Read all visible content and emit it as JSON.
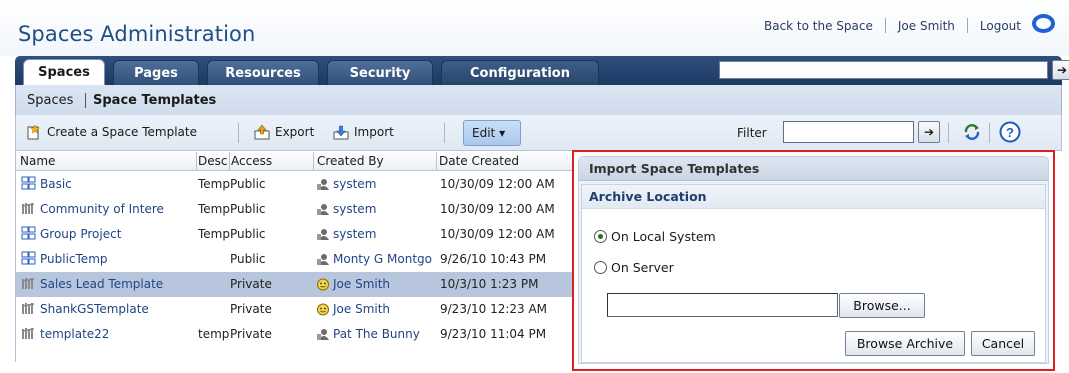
{
  "header": {
    "title": "Spaces Administration",
    "back_link": "Back to the Space",
    "user": "Joe Smith",
    "logout": "Logout"
  },
  "tabs": [
    {
      "label": "Spaces",
      "active": true
    },
    {
      "label": "Pages",
      "active": false
    },
    {
      "label": "Resources",
      "active": false
    },
    {
      "label": "Security",
      "active": false
    },
    {
      "label": "Configuration",
      "active": false
    }
  ],
  "tabs_search": {
    "placeholder": "",
    "go_glyph": "➔"
  },
  "breadcrumb": {
    "root": "Spaces",
    "current": "Space Templates"
  },
  "toolbar": {
    "create": "Create a Space Template",
    "export": "Export",
    "import": "Import",
    "edit": "Edit",
    "edit_caret": "▾",
    "filter_label": "Filter",
    "filter_value": "",
    "go_glyph": "➔",
    "help_glyph": "?"
  },
  "table": {
    "headers": {
      "name": "Name",
      "desc": "Desc",
      "access": "Access",
      "created_by": "Created By",
      "date": "Date Created"
    },
    "rows": [
      {
        "name": "Basic",
        "desc": "Temp",
        "access": "Public",
        "created_by": "system",
        "date": "10/30/09 12:00 AM",
        "icon": "template-icon",
        "user_icon": "system-user-icon",
        "selected": false
      },
      {
        "name": "Community of Intere",
        "desc": "Temp",
        "access": "Public",
        "created_by": "system",
        "date": "10/30/09 12:00 AM",
        "icon": "community-template-icon",
        "user_icon": "system-user-icon",
        "selected": false
      },
      {
        "name": "Group Project",
        "desc": "Temp",
        "access": "Public",
        "created_by": "system",
        "date": "10/30/09 12:00 AM",
        "icon": "template-icon",
        "user_icon": "system-user-icon",
        "selected": false
      },
      {
        "name": "PublicTemp",
        "desc": "",
        "access": "Public",
        "created_by": "Monty G Montgo",
        "date": "9/26/10 10:43 PM",
        "icon": "template-icon",
        "user_icon": "user-icon",
        "selected": false
      },
      {
        "name": "Sales Lead Template",
        "desc": "",
        "access": "Private",
        "created_by": "Joe Smith",
        "date": "10/3/10 1:23 PM",
        "icon": "community-template-icon",
        "user_icon": "current-user-icon",
        "selected": true
      },
      {
        "name": "ShankGSTemplate",
        "desc": "",
        "access": "Private",
        "created_by": "Joe Smith",
        "date": "9/23/10 12:23 AM",
        "icon": "community-template-icon",
        "user_icon": "current-user-icon",
        "selected": false
      },
      {
        "name": "template22",
        "desc": "temp",
        "access": "Private",
        "created_by": "Pat The Bunny",
        "date": "9/23/10 11:04 PM",
        "icon": "community-template-icon",
        "user_icon": "user-icon",
        "selected": false
      }
    ]
  },
  "import_panel": {
    "title": "Import Space Templates",
    "section": "Archive Location",
    "options": [
      {
        "label": "On Local System",
        "checked": true
      },
      {
        "label": "On Server",
        "checked": false
      }
    ],
    "file_value": "",
    "browse": "Browse...",
    "browse_archive": "Browse Archive",
    "cancel": "Cancel"
  },
  "colors": {
    "accent": "#1d63d2",
    "tab_band": "#2f4f7e",
    "selected_row": "#b7c6dc",
    "highlight_border": "#e02020"
  }
}
